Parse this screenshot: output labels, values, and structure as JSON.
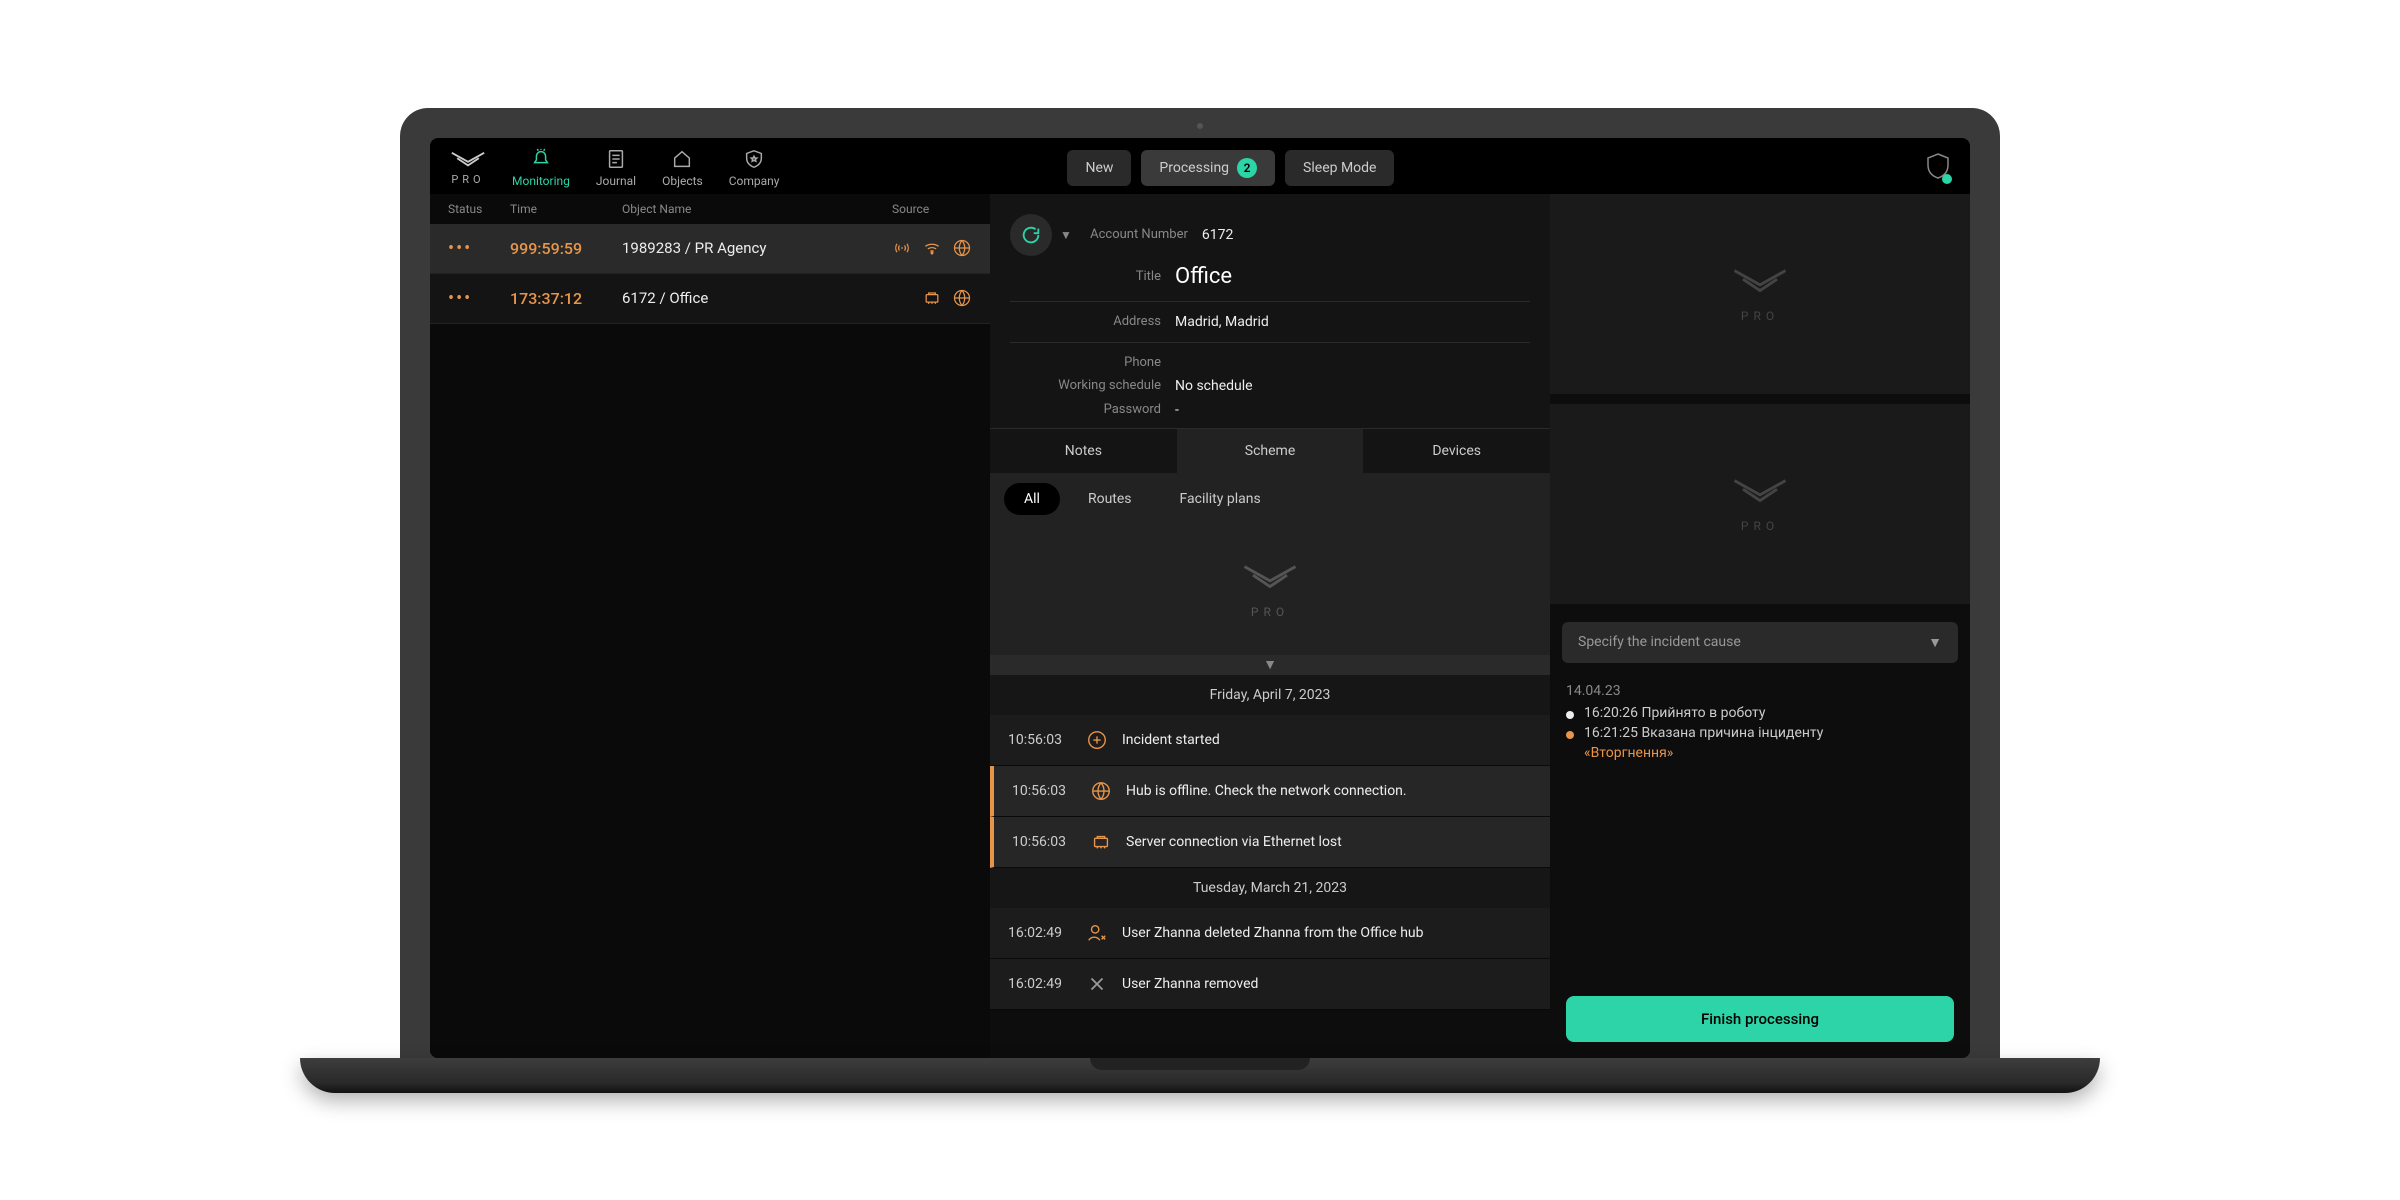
{
  "brand": "PRO",
  "nav": {
    "monitoring": "Monitoring",
    "journal": "Journal",
    "objects": "Objects",
    "company": "Company"
  },
  "topTabs": {
    "new": "New",
    "processing": "Processing",
    "processing_count": "2",
    "sleep": "Sleep Mode"
  },
  "listHead": {
    "status": "Status",
    "time": "Time",
    "name": "Object Name",
    "source": "Source"
  },
  "incidents": [
    {
      "time": "999:59:59",
      "name": "1989283 / PR Agency"
    },
    {
      "time": "173:37:12",
      "name": "6172 / Office"
    }
  ],
  "detail": {
    "account_lbl": "Account Number",
    "account": "6172",
    "title_lbl": "Title",
    "title": "Office",
    "address_lbl": "Address",
    "address": "Madrid, Madrid",
    "phone_lbl": "Phone",
    "phone": "",
    "schedule_lbl": "Working schedule",
    "schedule": "No schedule",
    "password_lbl": "Password",
    "password": "-"
  },
  "midTabs": {
    "notes": "Notes",
    "scheme": "Scheme",
    "devices": "Devices"
  },
  "subTabs": {
    "all": "All",
    "routes": "Routes",
    "plans": "Facility plans"
  },
  "events": {
    "d1": "Friday, April 7, 2023",
    "e1": {
      "t": "10:56:03",
      "txt": "Incident started"
    },
    "e2": {
      "t": "10:56:03",
      "txt": "Hub is offline. Check the network connection."
    },
    "e3": {
      "t": "10:56:03",
      "txt": "Server connection via Ethernet lost"
    },
    "d2": "Tuesday, March 21, 2023",
    "e4": {
      "t": "16:02:49",
      "txt": "User Zhanna deleted Zhanna from the Office hub"
    },
    "e5": {
      "t": "16:02:49",
      "txt": "User Zhanna removed"
    }
  },
  "cause_placeholder": "Specify the incident cause",
  "log": {
    "date": "14.04.23",
    "l1": "16:20:26 Прийнято в роботу",
    "l2": "16:21:25 Вказана причина інциденту",
    "l2sub": "«Вторгнення»"
  },
  "finish": "Finish processing"
}
